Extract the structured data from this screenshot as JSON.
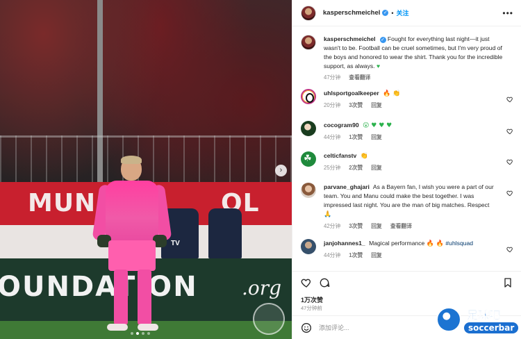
{
  "media": {
    "banner_word_left": "MUN",
    "banner_word_right": "OL",
    "foundation_text": "OUNDATION",
    "org_text": ".org",
    "steward_vest_text": "TV",
    "carousel_dots": 4,
    "carousel_active_index": 1
  },
  "header": {
    "owner_username": "kasperschmeichel",
    "verified_glyph": "✓",
    "separator": "•",
    "follow_label": "关注",
    "more_glyph": "•••"
  },
  "caption": {
    "username": "kasperschmeichel",
    "text": "Fought for everything last night—it just wasn't to be. Football can be cruel sometimes, but I'm very proud of the boys and honored to wear the shirt. Thank you for the incredible support, as always.",
    "emoji": "♥",
    "time": "47分钟",
    "translate_label": "查看翻译"
  },
  "comments": [
    {
      "username": "uhlsportgoalkeeper",
      "text": "",
      "emojis": "🔥 👏",
      "time": "20分钟",
      "likes": "3次赞",
      "reply": "回复",
      "translate": ""
    },
    {
      "username": "cocogram90",
      "text": "",
      "emojis": "😮 ♥ ♥ ♥",
      "time": "44分钟",
      "likes": "1次赞",
      "reply": "回复",
      "translate": ""
    },
    {
      "username": "celticfanstv",
      "text": "",
      "emojis": "👏",
      "time": "25分钟",
      "likes": "2次赞",
      "reply": "回复",
      "translate": ""
    },
    {
      "username": "parvane_ghajari",
      "text": "As a Bayern fan, I wish you were a part of our team. You and Manu could make the best together. I was impressed last night. You are the man of big matches. Respect",
      "emojis": "🙏",
      "time": "42分钟",
      "likes": "3次赞",
      "reply": "回复",
      "translate": "查看翻译"
    },
    {
      "username": "janjohannes1_",
      "text": "Magical performance",
      "emojis": "🔥 🔥",
      "tag": "#uhlsquad",
      "time": "44分钟",
      "likes": "1次赞",
      "reply": "回复",
      "translate": ""
    }
  ],
  "actions": {
    "likes_count": "1万次赞",
    "posted_ago": "47分钟前"
  },
  "add_comment": {
    "placeholder": "添加评论..."
  },
  "watermark": {
    "cn": "足球吧",
    "en": "soccerbar"
  },
  "icons": [
    "heart-icon",
    "comment-icon",
    "bookmark-icon",
    "smiley-icon",
    "chevron-right-icon",
    "verified-icon",
    "more-icon"
  ],
  "colors": {
    "accent": "#0095f6",
    "verified": "#3897f0",
    "green_heart": "#2bb24c",
    "fire": "#f07a1a",
    "keeper_kit": "#f24ea4"
  }
}
